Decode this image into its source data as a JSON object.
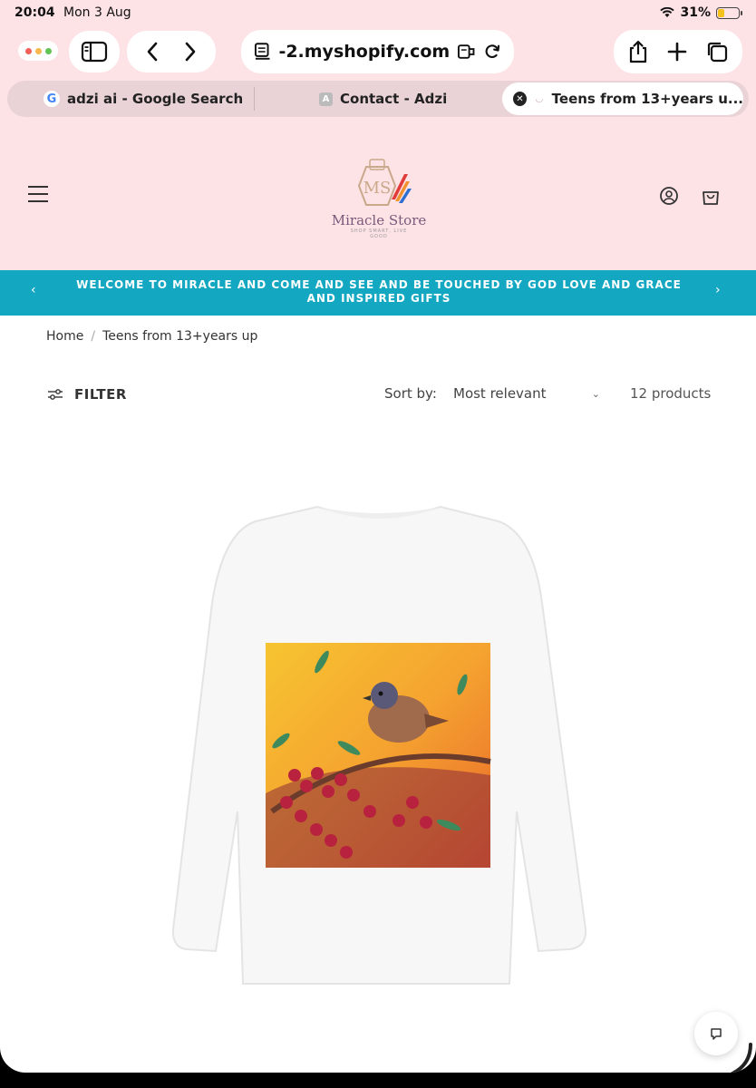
{
  "status_bar": {
    "time": "20:04",
    "date": "Mon 3 Aug",
    "battery": "31%"
  },
  "browser": {
    "url": "-2.myshopify.com",
    "tabs": [
      {
        "label": "adzi ai - Google Search",
        "icon": "google-icon"
      },
      {
        "label": "Contact - Adzi",
        "icon": "a-favicon"
      },
      {
        "label": "Teens from 13+years u...",
        "icon": "store-favicon",
        "active": true
      }
    ]
  },
  "store": {
    "logo_monogram": "MS",
    "logo_name": "Miracle Store",
    "logo_tagline": "SHOP SMART, LIVE GOOD",
    "announcement": "WELCOME TO MIRACLE AND COME AND SEE AND BE TOUCHED BY GOD LOVE AND GRACE AND INSPIRED GIFTS",
    "accent_color": "#13a7c1",
    "header_bg": "#fde2e6"
  },
  "breadcrumb": {
    "home": "Home",
    "sep": "/",
    "current": "Teens from 13+years up"
  },
  "toolbar": {
    "filter_label": "FILTER",
    "sort_label": "Sort by:",
    "sort_value": "Most relevant",
    "product_count": "12 products"
  }
}
